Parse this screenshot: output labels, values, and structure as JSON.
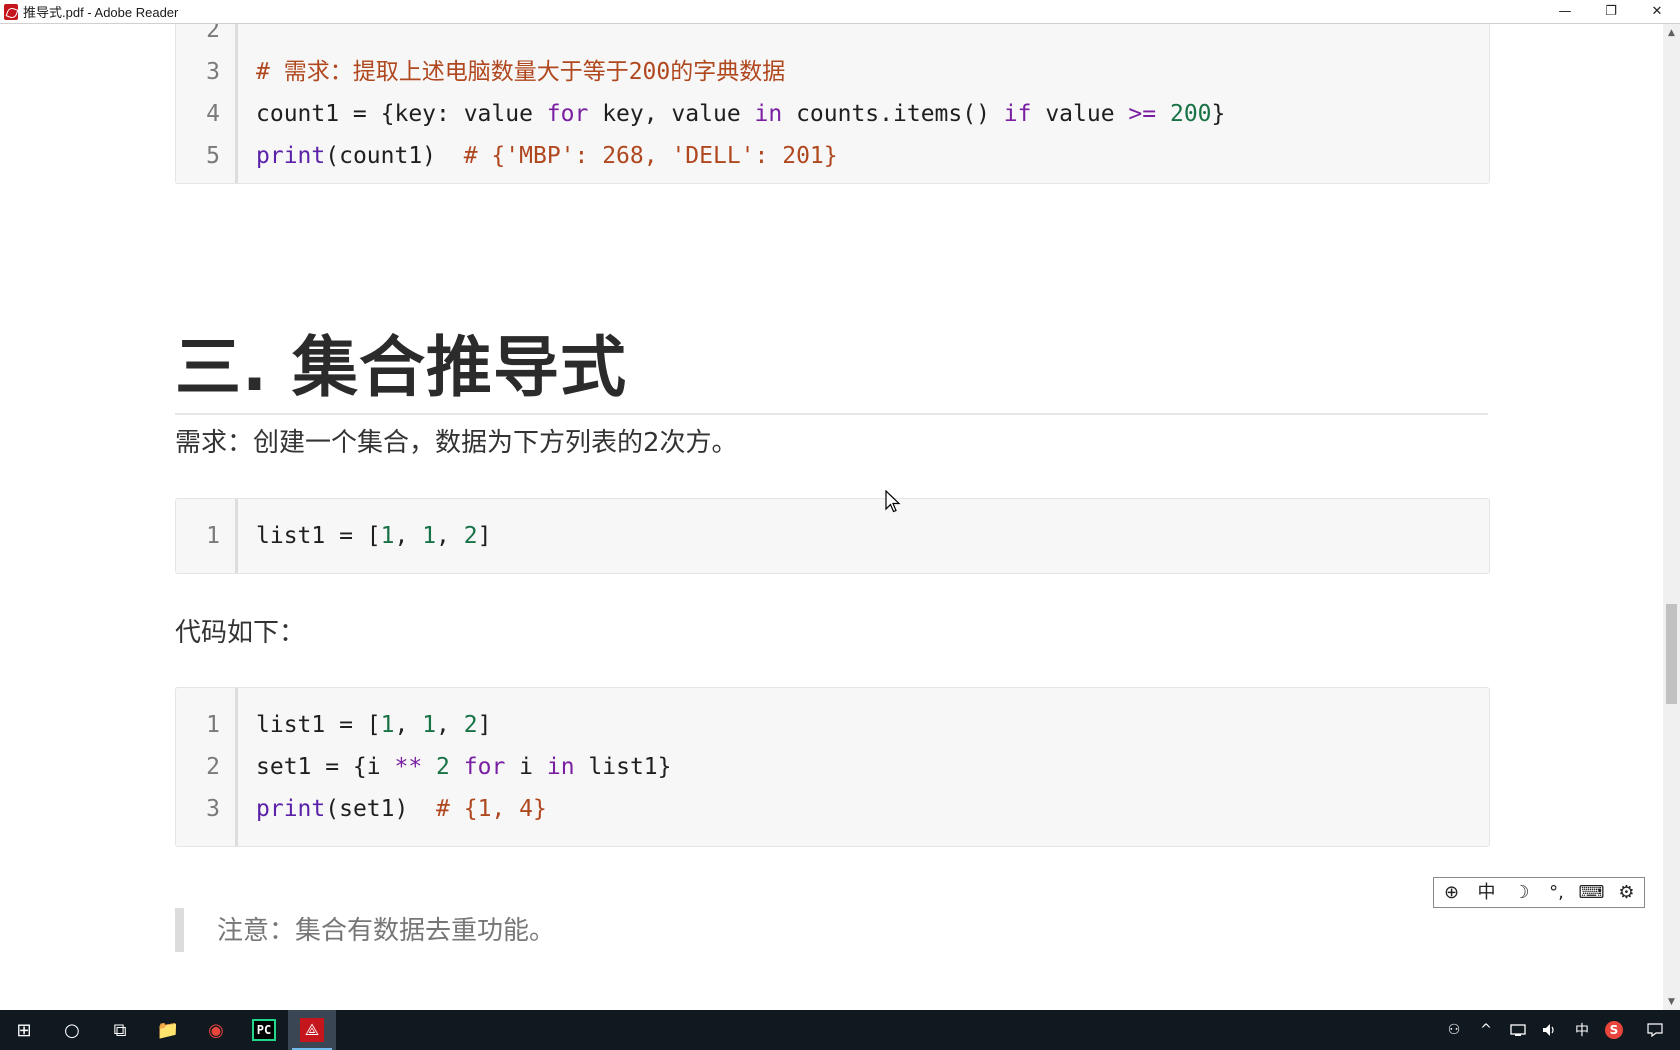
{
  "window": {
    "title": "推导式.pdf - Adobe Reader",
    "minimize_glyph": "—",
    "restore_glyph": "❐",
    "close_glyph": "✕"
  },
  "document": {
    "code_block_1": {
      "lines": [
        {
          "num": "2",
          "tokens": []
        },
        {
          "num": "3",
          "tokens": [
            {
              "t": "# 需求：提取上述电脑数量大于等于200的字典数据",
              "c": "cmt"
            }
          ]
        },
        {
          "num": "4",
          "tokens": [
            {
              "t": "count1 = {key: value ",
              "c": ""
            },
            {
              "t": "for",
              "c": "kw"
            },
            {
              "t": " key, value ",
              "c": ""
            },
            {
              "t": "in",
              "c": "kw"
            },
            {
              "t": " counts.items() ",
              "c": ""
            },
            {
              "t": "if",
              "c": "kw"
            },
            {
              "t": " value ",
              "c": ""
            },
            {
              "t": ">=",
              "c": "kw"
            },
            {
              "t": " ",
              "c": ""
            },
            {
              "t": "200",
              "c": "num"
            },
            {
              "t": "}",
              "c": ""
            }
          ]
        },
        {
          "num": "5",
          "tokens": [
            {
              "t": "print",
              "c": "fn"
            },
            {
              "t": "(count1)  ",
              "c": ""
            },
            {
              "t": "# {'MBP': 268, 'DELL': 201}",
              "c": "cmt"
            }
          ]
        }
      ]
    },
    "heading": "三. 集合推导式",
    "requirement_text": "需求：创建一个集合，数据为下方列表的2次方。",
    "code_block_2": {
      "lines": [
        {
          "num": "1",
          "tokens": [
            {
              "t": "list1 = [",
              "c": ""
            },
            {
              "t": "1",
              "c": "num"
            },
            {
              "t": ", ",
              "c": ""
            },
            {
              "t": "1",
              "c": "num"
            },
            {
              "t": ", ",
              "c": ""
            },
            {
              "t": "2",
              "c": "num"
            },
            {
              "t": "]",
              "c": ""
            }
          ]
        }
      ]
    },
    "code_intro": "代码如下：",
    "code_block_3": {
      "lines": [
        {
          "num": "1",
          "tokens": [
            {
              "t": "list1 = [",
              "c": ""
            },
            {
              "t": "1",
              "c": "num"
            },
            {
              "t": ", ",
              "c": ""
            },
            {
              "t": "1",
              "c": "num"
            },
            {
              "t": ", ",
              "c": ""
            },
            {
              "t": "2",
              "c": "num"
            },
            {
              "t": "]",
              "c": ""
            }
          ]
        },
        {
          "num": "2",
          "tokens": [
            {
              "t": "set1 = {i ",
              "c": ""
            },
            {
              "t": "**",
              "c": "kw"
            },
            {
              "t": " ",
              "c": ""
            },
            {
              "t": "2",
              "c": "num"
            },
            {
              "t": " ",
              "c": ""
            },
            {
              "t": "for",
              "c": "kw"
            },
            {
              "t": " i ",
              "c": ""
            },
            {
              "t": "in",
              "c": "kw"
            },
            {
              "t": " list1}",
              "c": ""
            }
          ]
        },
        {
          "num": "3",
          "tokens": [
            {
              "t": "print",
              "c": "fn"
            },
            {
              "t": "(set1)  ",
              "c": ""
            },
            {
              "t": "# {1, 4}",
              "c": "cmt"
            }
          ]
        }
      ]
    },
    "note": "注意：集合有数据去重功能。"
  },
  "ime_toolbar": {
    "items": [
      {
        "name": "ime-logo-icon",
        "glyph": "⊕"
      },
      {
        "name": "ime-mode-chinese",
        "glyph": "中"
      },
      {
        "name": "ime-moon-icon",
        "glyph": "☽"
      },
      {
        "name": "ime-punctuation-icon",
        "glyph": "°,"
      },
      {
        "name": "ime-keyboard-icon",
        "glyph": "⌨"
      },
      {
        "name": "ime-settings-icon",
        "glyph": "⚙"
      }
    ]
  },
  "taskbar": {
    "start_glyph": "⊞",
    "search_glyph": "○",
    "taskview_glyph": "⧉",
    "explorer_glyph": "📁",
    "chrome_glyph": "◉",
    "pycharm_glyph": "PC",
    "reader_glyph": "⟁",
    "tray": {
      "people_glyph": "⚇",
      "chevron_glyph": "^",
      "ime_glyph": "中",
      "sogou_glyph": "S"
    }
  }
}
